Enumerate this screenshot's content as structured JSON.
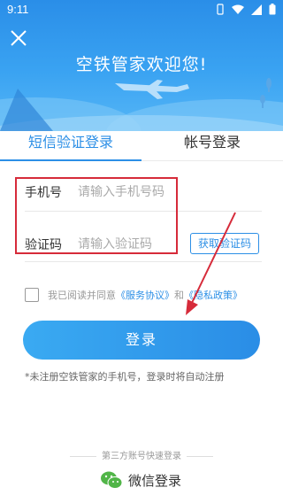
{
  "status_bar": {
    "time": "9:11"
  },
  "header": {
    "title": "空铁管家欢迎您!"
  },
  "tabs": [
    {
      "label": "短信验证登录",
      "active": true
    },
    {
      "label": "帐号登录",
      "active": false
    }
  ],
  "form": {
    "phone": {
      "label": "手机号",
      "placeholder": "请输入手机号码",
      "value": ""
    },
    "code": {
      "label": "验证码",
      "placeholder": "请输入验证码",
      "value": ""
    },
    "get_code_label": "获取验证码"
  },
  "agreement": {
    "prefix": "我已阅读并同意",
    "service_link": "《服务协议》",
    "and": "和",
    "privacy_link": "《隐私政策》",
    "checked": false
  },
  "login_button": "登录",
  "note": "*未注册空铁管家的手机号，登录时将自动注册",
  "third_party": {
    "title": "第三方账号快速登录",
    "wechat_label": "微信登录"
  },
  "colors": {
    "accent": "#2c8fe6",
    "highlight": "#d62b3a",
    "wechat": "#51b548"
  }
}
